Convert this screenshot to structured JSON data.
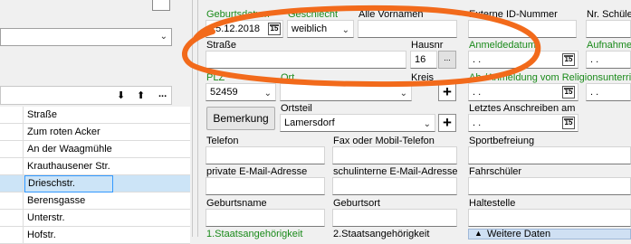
{
  "personal": {
    "geburtsdatum_label": "Geburtsdatum",
    "geburtsdatum_value": "15.12.2018",
    "geschlecht_label": "Geschlecht",
    "geschlecht_value": "weiblich",
    "alle_vornamen_label": "Alle Vornamen"
  },
  "address": {
    "strasse_label": "Straße",
    "hausnr_label": "Hausnr",
    "hausnr_value": "16",
    "hausnr_button": "...",
    "plz_label": "PLZ",
    "plz_value": "52459",
    "ort_label": "Ort",
    "kreis_label": "Kreis",
    "ortsteil_label": "Ortsteil",
    "ortsteil_value": "Lamersdorf",
    "bemerkung_button": "Bemerkung",
    "plus": "+"
  },
  "contact": {
    "telefon_label": "Telefon",
    "fax_label": "Fax oder Mobil-Telefon",
    "email_label": "private E-Mail-Adresse",
    "school_email_label": "schulinterne E-Mail-Adresse",
    "geburtsname_label": "Geburtsname",
    "geburtsort_label": "Geburtsort",
    "staat1_label": "1.Staatsangehörigkeit",
    "staat2_label": "2.Staatsangehörigkeit"
  },
  "right": {
    "externe_id_label": "Externe ID-Nummer",
    "nr_schueler_label": "Nr. Schüle",
    "anmeldedatum_label": "Anmeldedatum",
    "anmeldedatum_value": " .  .",
    "aufnahme_label": "Aufnahme",
    "aufnahme_value": " .  .",
    "religion_label": "Ab-/Anmeldung vom Religionsunterric",
    "religion_value1": " .  .",
    "religion_value2": " .  .",
    "letztes_label": "Letztes Anschreiben am",
    "letztes_value": " .  .",
    "sportbefreiung_label": "Sportbefreiung",
    "fahrschueler_label": "Fahrschüler",
    "haltestelle_label": "Haltestelle",
    "weitere_label": "Weitere Daten",
    "cal_glyph": "15"
  },
  "left": {
    "toolbar_down": "⬇",
    "toolbar_up": "⬆",
    "toolbar_more": "...",
    "column_header": "Straße",
    "streets": [
      "Zum roten Acker",
      "An der Waagmühle",
      "Krauthausener Str.",
      "Drieschstr.",
      "Berensgasse",
      "Unterstr.",
      "Hofstr."
    ],
    "selected_index": 3
  },
  "colors": {
    "green_label": "#1a8a1a",
    "annotation_orange": "#f26a1b",
    "selection": "#cce4f7",
    "panel_blue": "#cfe0f3"
  }
}
